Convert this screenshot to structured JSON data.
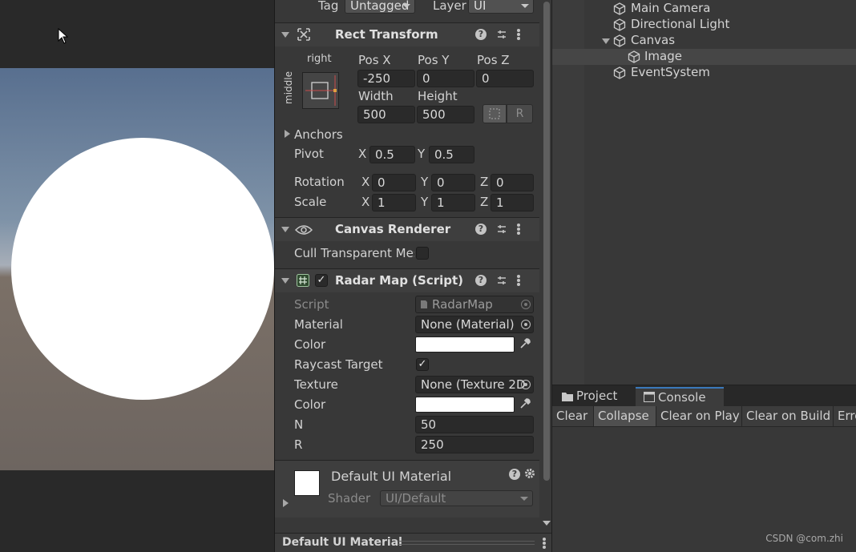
{
  "inspector": {
    "top_row": {
      "tag_label": "Tag",
      "tag_value": "Untagged",
      "layer_label": "Layer",
      "layer_value": "UI"
    },
    "rect_transform": {
      "title": "Rect Transform",
      "anchor_preset_h": "right",
      "anchor_preset_v": "middle",
      "pos_x_label": "Pos X",
      "pos_y_label": "Pos Y",
      "pos_z_label": "Pos Z",
      "pos_x": "-250",
      "pos_y": "0",
      "pos_z": "0",
      "width_label": "Width",
      "height_label": "Height",
      "width": "500",
      "height": "500",
      "raw_button": "R",
      "anchors_label": "Anchors",
      "pivot_label": "Pivot",
      "pivot_x_label": "X",
      "pivot_x": "0.5",
      "pivot_y_label": "Y",
      "pivot_y": "0.5",
      "rotation_label": "Rotation",
      "rot_x": "0",
      "rot_y": "0",
      "rot_z": "0",
      "scale_label": "Scale",
      "scale_x": "1",
      "scale_y": "1",
      "scale_z": "1",
      "x_label": "X",
      "y_label": "Y",
      "z_label": "Z"
    },
    "canvas_renderer": {
      "title": "Canvas Renderer",
      "cull_label": "Cull Transparent Mes"
    },
    "radar_map": {
      "title": "Radar Map (Script)",
      "checked": "✓",
      "script_label": "Script",
      "script_value": "RadarMap",
      "material_label": "Material",
      "material_value": "None (Material)",
      "color_label": "Color",
      "raycast_label": "Raycast Target",
      "raycast_checked": "✓",
      "texture_label": "Texture",
      "texture_value": "None (Texture 2D",
      "color2_label": "Color",
      "n_label": "N",
      "n_value": "50",
      "r_label": "R",
      "r_value": "250"
    },
    "material": {
      "name": "Default UI Material",
      "shader_label": "Shader",
      "shader_value": "UI/Default"
    },
    "footer_title": "Default UI Material"
  },
  "hierarchy": {
    "items": [
      {
        "label": "Main Camera"
      },
      {
        "label": "Directional Light"
      },
      {
        "label": "Canvas"
      },
      {
        "label": "Image"
      },
      {
        "label": "EventSystem"
      }
    ]
  },
  "console": {
    "tabs": [
      {
        "label": "Project"
      },
      {
        "label": "Console"
      }
    ],
    "toolbar": [
      {
        "label": "Clear"
      },
      {
        "label": "Collapse"
      },
      {
        "label": "Clear on Play"
      },
      {
        "label": "Clear on Build"
      },
      {
        "label": "Erro"
      }
    ]
  },
  "watermark": "CSDN @com.zhi",
  "colors": {
    "accent": "#3a79bb",
    "panel": "#383838",
    "field": "#2a2a2a",
    "swatch": "#ffffff"
  }
}
